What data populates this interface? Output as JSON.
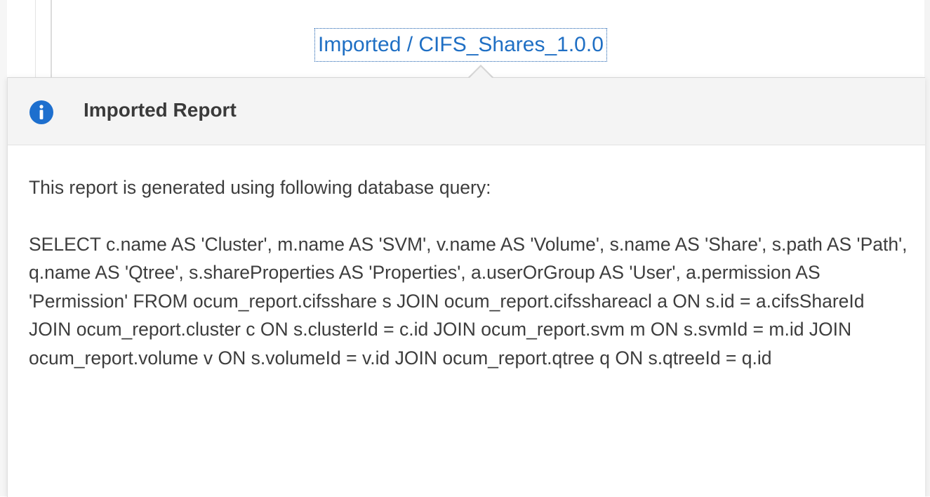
{
  "link": {
    "label": "Imported / CIFS_Shares_1.0.0"
  },
  "popover": {
    "icon": "info-icon",
    "title": "Imported Report",
    "intro": "This report is generated using following database query:",
    "query": "SELECT c.name AS 'Cluster', m.name AS 'SVM', v.name AS 'Volume', s.name AS 'Share', s.path AS 'Path', q.name AS 'Qtree', s.shareProperties AS 'Properties', a.userOrGroup AS 'User', a.permission AS 'Permission' FROM ocum_report.cifsshare s JOIN ocum_report.cifsshareacl a ON s.id = a.cifsShareId JOIN ocum_report.cluster c ON s.clusterId = c.id JOIN ocum_report.svm m ON s.svmId = m.id JOIN ocum_report.volume v ON s.volumeId = v.id JOIN ocum_report.qtree q ON s.qtreeId = q.id"
  },
  "colors": {
    "link": "#1f6fc4",
    "info_icon": "#1d6fce",
    "header_bg": "#f4f4f4",
    "body_text": "#3d3d3d"
  }
}
